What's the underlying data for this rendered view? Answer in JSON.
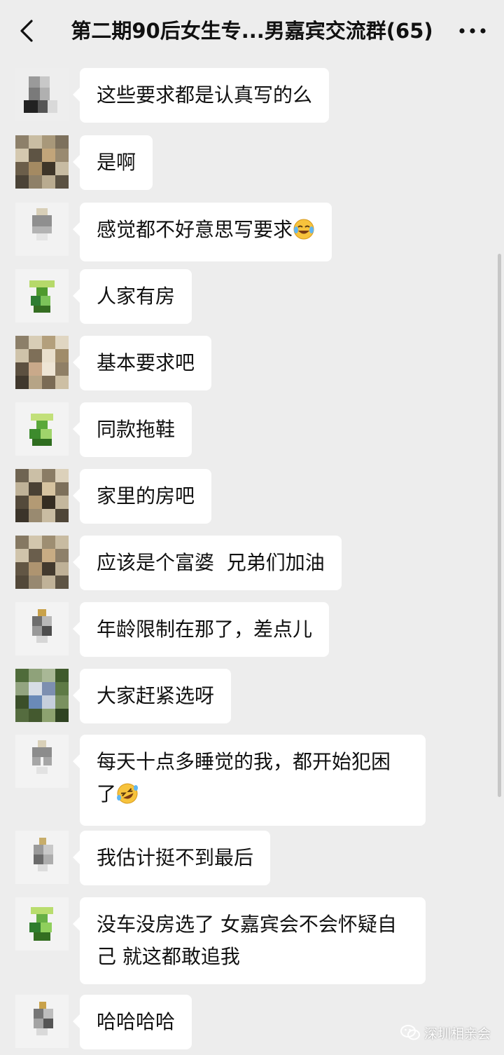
{
  "header": {
    "title": "第二期90后女生专...男嘉宾交流群(65)"
  },
  "messages": [
    {
      "text": "这些要求都是认真写的么"
    },
    {
      "text": "是啊"
    },
    {
      "text": "感觉都不好意思写要求"
    },
    {
      "text": "人家有房"
    },
    {
      "text": "基本要求吧"
    },
    {
      "text": "同款拖鞋"
    },
    {
      "text": "家里的房吧"
    },
    {
      "text": "应该是个富婆  兄弟们加油"
    },
    {
      "text": "年龄限制在那了，差点儿"
    },
    {
      "text": "大家赶紧选呀"
    },
    {
      "text": "每天十点多睡觉的我，都开始犯困了"
    },
    {
      "text": "我估计挺不到最后"
    },
    {
      "text": "没车没房选了 女嘉宾会不会怀疑自己 就这都敢追我"
    },
    {
      "text": "哈哈哈哈"
    }
  ],
  "watermark": {
    "text": "深圳相亲会"
  },
  "icons": {
    "back": "chevron-left-icon",
    "more": "more-dots-icon",
    "emoji_tears": "tears-of-joy-emoji",
    "emoji_rofl": "rolling-laughing-emoji",
    "watermark_logo": "wechat-logo-icon"
  }
}
